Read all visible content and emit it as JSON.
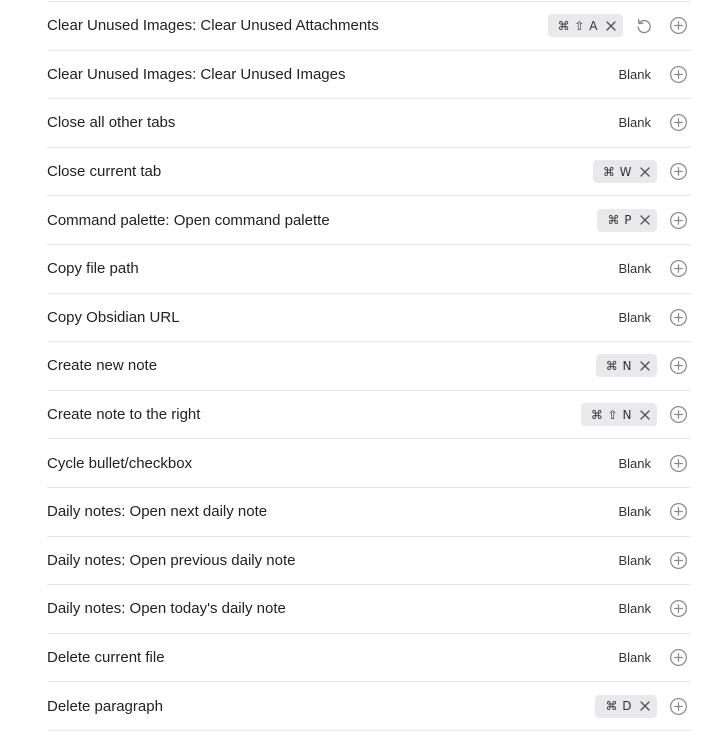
{
  "blank_label": "Blank",
  "icons": {
    "add": "plus-circle-icon",
    "remove": "close-icon",
    "reset": "reset-icon"
  },
  "colors": {
    "hotkey_bg": "#e9e9eb",
    "divider": "#e6e6e6",
    "icon": "#8a8a8e"
  },
  "commands": [
    {
      "label": "Clear Unused Images: Clear Unused Attachments",
      "hotkey": "⌘ ⇧ A",
      "reset": true
    },
    {
      "label": "Clear Unused Images: Clear Unused Images",
      "hotkey": null
    },
    {
      "label": "Close all other tabs",
      "hotkey": null
    },
    {
      "label": "Close current tab",
      "hotkey": "⌘ W"
    },
    {
      "label": "Command palette: Open command palette",
      "hotkey": "⌘ P"
    },
    {
      "label": "Copy file path",
      "hotkey": null
    },
    {
      "label": "Copy Obsidian URL",
      "hotkey": null
    },
    {
      "label": "Create new note",
      "hotkey": "⌘ N"
    },
    {
      "label": "Create note to the right",
      "hotkey": "⌘ ⇧ N"
    },
    {
      "label": "Cycle bullet/checkbox",
      "hotkey": null
    },
    {
      "label": "Daily notes: Open next daily note",
      "hotkey": null
    },
    {
      "label": "Daily notes: Open previous daily note",
      "hotkey": null
    },
    {
      "label": "Daily notes: Open today's daily note",
      "hotkey": null
    },
    {
      "label": "Delete current file",
      "hotkey": null
    },
    {
      "label": "Delete paragraph",
      "hotkey": "⌘ D"
    }
  ]
}
